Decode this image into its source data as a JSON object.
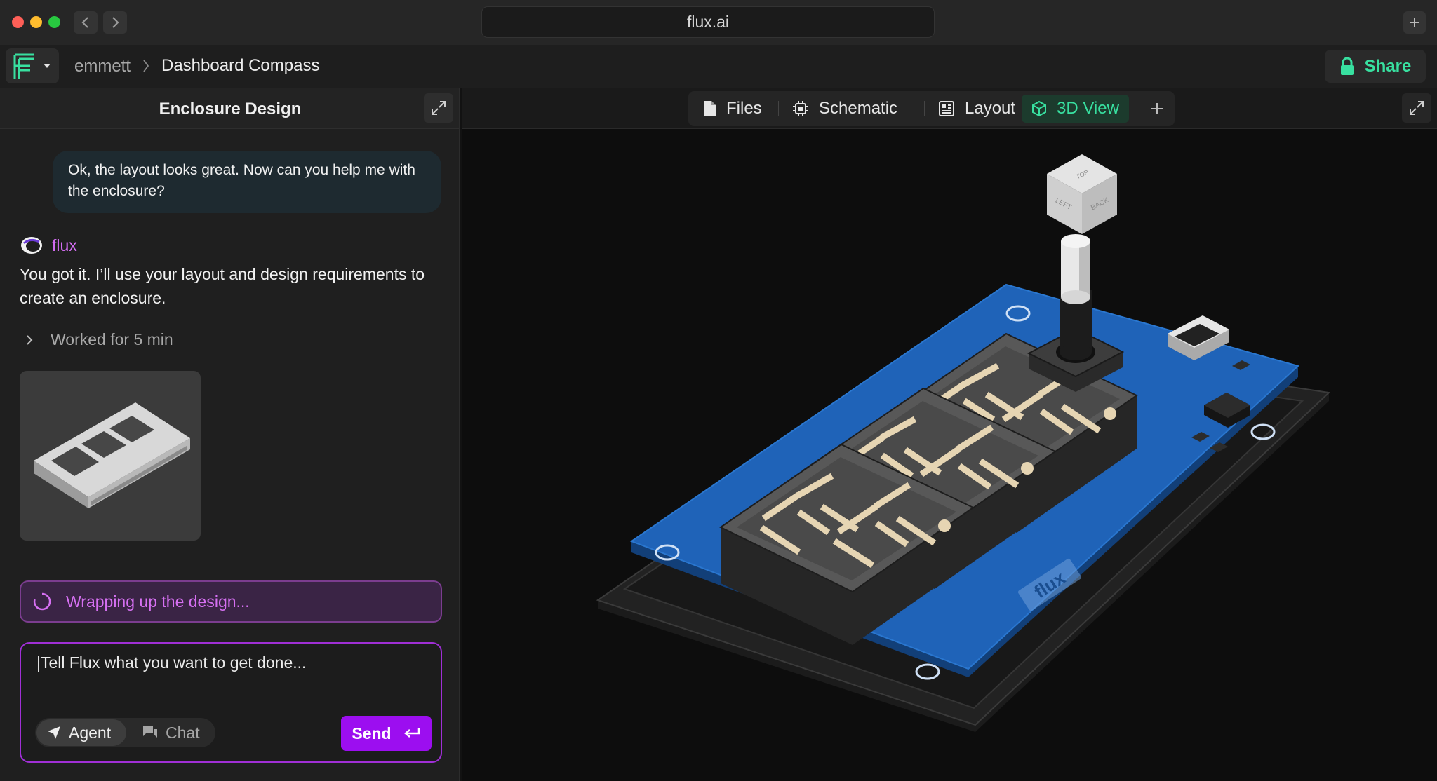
{
  "window": {
    "url": "flux.ai"
  },
  "header": {
    "breadcrumb_user": "emmett",
    "breadcrumb_project": "Dashboard Compass",
    "share_label": "Share"
  },
  "left_panel": {
    "title": "Enclosure Design",
    "user_message": "Ok, the layout looks great. Now can you help me with the enclosure?",
    "assistant_name": "flux",
    "assistant_message": "You got it. I’ll use your layout and design requirements to create an enclosure.",
    "worked_label": "Worked for 5 min",
    "status_text": "Wrapping up the design...",
    "prompt_placeholder": "|Tell Flux what you want to get done...",
    "mode_agent_label": "Agent",
    "mode_chat_label": "Chat",
    "send_label": "Send"
  },
  "tabs": [
    {
      "label": "Files",
      "icon": "file-icon",
      "active": false
    },
    {
      "label": "Schematic",
      "icon": "chip-icon",
      "active": false
    },
    {
      "label": "Layout",
      "icon": "layout-icon",
      "active": false
    },
    {
      "label": "3D View",
      "icon": "cube-icon",
      "active": true
    }
  ],
  "viewport": {
    "view_cube_labels": [
      "TOP",
      "LEFT",
      "BACK"
    ],
    "board_label": "flux"
  },
  "colors": {
    "accent_green": "#38e0a0",
    "accent_purple": "#9c0ef0",
    "pcb_blue": "#1f63b8"
  }
}
